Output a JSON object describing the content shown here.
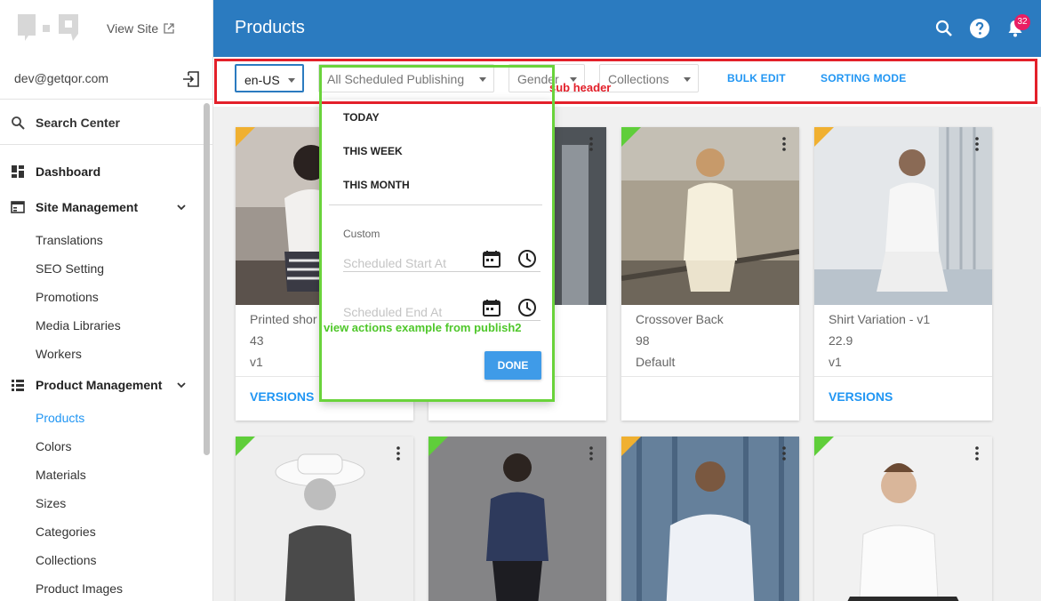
{
  "sidebar": {
    "view_site": "View Site",
    "user_email": "dev@getqor.com",
    "search_center": "Search Center",
    "sections": [
      {
        "label": "Dashboard",
        "icon": "dashboard-icon"
      },
      {
        "label": "Site Management",
        "icon": "site-management-icon",
        "items": [
          "Translations",
          "SEO Setting",
          "Promotions",
          "Media Libraries",
          "Workers"
        ]
      },
      {
        "label": "Product Management",
        "icon": "list-icon",
        "items": [
          "Products",
          "Colors",
          "Materials",
          "Sizes",
          "Categories",
          "Collections",
          "Product Images"
        ]
      }
    ],
    "active_item": "Products"
  },
  "header": {
    "title": "Products",
    "notification_count": "32"
  },
  "subheader": {
    "locale": "en-US",
    "publishing_filter": "All Scheduled Publishing",
    "gender_filter": "Gender",
    "collections_filter": "Collections",
    "bulk_edit": "BULK EDIT",
    "sorting_mode": "SORTING MODE",
    "annotation_label": "sub header"
  },
  "dropdown": {
    "options": [
      "TODAY",
      "THIS WEEK",
      "THIS MONTH"
    ],
    "custom_label": "Custom",
    "start_placeholder": "Scheduled Start At",
    "end_placeholder": "Scheduled End At",
    "done_label": "DONE",
    "annotation_label": "view actions example from publish2"
  },
  "products": [
    {
      "name": "Printed shor",
      "value": "43",
      "variant": "v1",
      "versions": "VERSIONS",
      "status_color": "#f0b030"
    },
    {
      "name": "",
      "value": "",
      "variant": "",
      "versions": "",
      "status_color": "#5fce3a"
    },
    {
      "name": "Crossover Back",
      "value": "98",
      "variant": "Default",
      "versions": "",
      "status_color": "#5fce3a"
    },
    {
      "name": "Shirt Variation - v1",
      "value": "22.9",
      "variant": "v1",
      "versions": "VERSIONS",
      "status_color": "#f0b030"
    },
    {
      "status_color": "#5fce3a"
    },
    {
      "status_color": "#5fce3a"
    },
    {
      "status_color": "#f0b030"
    },
    {
      "status_color": "#5fce3a"
    }
  ],
  "colors": {
    "header_bg": "#2b7bc0",
    "accent": "#2196f3",
    "badge": "#e91e63",
    "annotation_red": "#e3202a",
    "annotation_green": "#6ad33b"
  }
}
